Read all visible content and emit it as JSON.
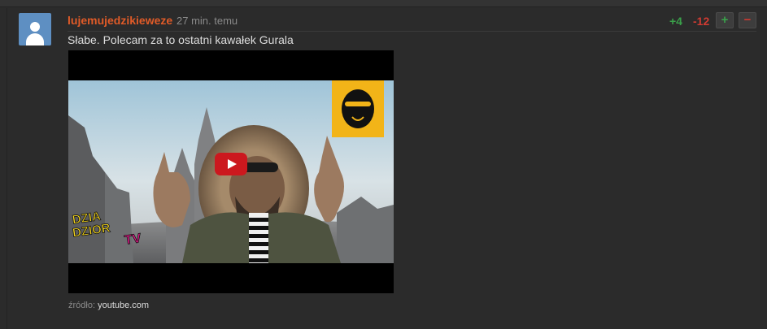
{
  "comment": {
    "username": "lujemujedzikieweze",
    "timestamp": "27 min. temu",
    "text": "Słabe. Polecam za to ostatni kawałek Gurala",
    "votes": {
      "plus": "+4",
      "minus": "-12",
      "plus_button": "+",
      "minus_button": "−"
    },
    "embed": {
      "source_label": "źródło:",
      "source_link": "youtube.com",
      "video_logo_text": [
        "DZIA",
        "DZIOR",
        "TV"
      ]
    }
  },
  "colors": {
    "username": "#e05b28",
    "plus": "#3aa14a",
    "minus": "#cf3b32",
    "background": "#2b2b2b",
    "avatar": "#5e8fc2",
    "youtube_red": "#cc181e"
  },
  "icons": {
    "avatar": "default-user-avatar-icon",
    "play": "youtube-play-icon"
  }
}
